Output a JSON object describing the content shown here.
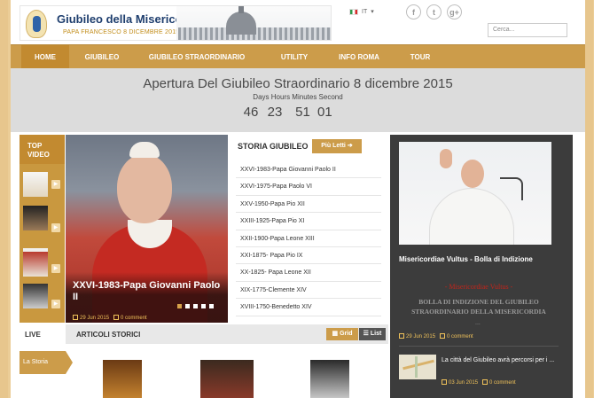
{
  "header": {
    "logo_title": "Giubileo della Misericordia",
    "logo_subtitle": "PAPA FRANCESCO 8 DICEMBRE 2015",
    "language": "IT",
    "social": [
      "f",
      "t",
      "g+"
    ],
    "search_placeholder": "Cerca..."
  },
  "nav": {
    "items": [
      "HOME",
      "GIUBILEO",
      "GIUBILEO STRAORDINARIO",
      "UTILITY",
      "INFO ROMA",
      "TOUR"
    ]
  },
  "countdown": {
    "title": "Apertura Del Giubileo Straordinario 8 dicembre 2015",
    "labels": "Days Hours Minutes Second",
    "days": "46",
    "hours": "23",
    "minutes": "51",
    "seconds": "01"
  },
  "top_video": {
    "title_line1": "TOP",
    "title_line2": "VIDEO"
  },
  "hero": {
    "title": "XXVI-1983-Papa Giovanni Paolo II",
    "date": "29 Jun 2015",
    "comments": "0 comment"
  },
  "storia": {
    "title": "STORIA GIUBILEO",
    "button": "Più Letti",
    "items": [
      "XXVI-1983-Papa Giovanni Paolo II",
      "XXVI-1975-Papa Paolo VI",
      "XXV-1950-Papa Pio XII",
      "XXIII-1925-Papa Pio XI",
      "XXII-1900-Papa Leone XIII",
      "XXI-1875- Papa Pio IX",
      "XX-1825- Papa Leone XII",
      "XIX-1775-Clemente XIV",
      "XVIII-1750-Benedetto XIV"
    ]
  },
  "sidebar": {
    "title": "Misericordiae Vultus - Bolla di Indizione",
    "red_text": "Misericordiae Vultus",
    "body": "BOLLA DI INDIZIONE DEL GIUBILEO STRAORDINARIO DELLA MISERICORDIA",
    "ellipsis": "...",
    "date": "29 Jun 2015",
    "comments": "0 comment",
    "article_title": "La città del Giubileo avrà percorsi per i ...",
    "article_date": "03 Jun 2015",
    "article_comments": "0 comment"
  },
  "bottom": {
    "live": "LIVE",
    "articoli": "ARTICOLI STORICI",
    "grid": "Grid",
    "list": "List",
    "la_storia": "La Storia"
  }
}
